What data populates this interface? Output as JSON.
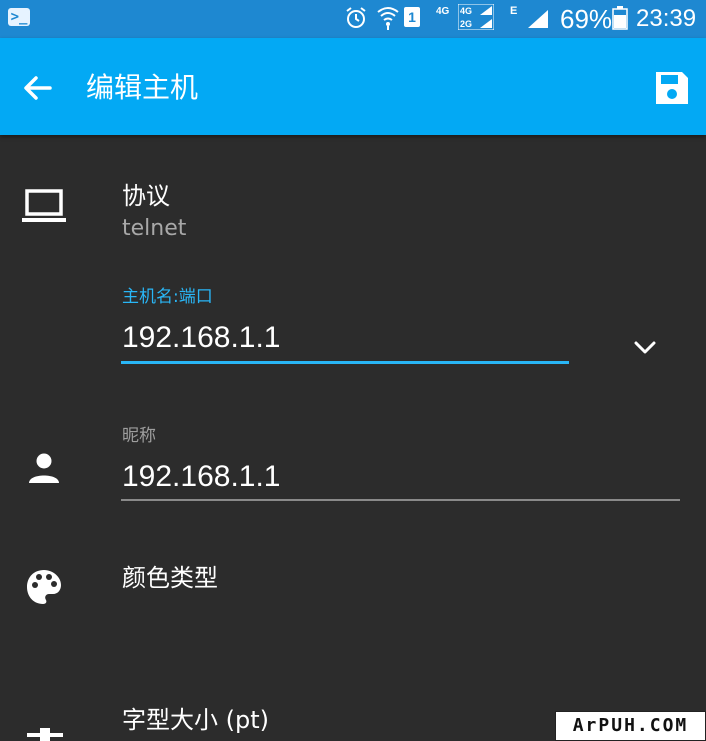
{
  "status_bar": {
    "network_4g": "4G",
    "network_e": "E",
    "sim_slot": "1",
    "battery_percent": "69%",
    "time": "23:39"
  },
  "app_bar": {
    "title": "编辑主机"
  },
  "protocol": {
    "label": "协议",
    "value": "telnet"
  },
  "host": {
    "label": "主机名:端口",
    "value": "192.168.1.1"
  },
  "nickname": {
    "label": "昵称",
    "value": "192.168.1.1"
  },
  "color_type": {
    "label": "颜色类型"
  },
  "font_size": {
    "label": "字型大小 (pt)"
  },
  "watermark": "ArPUH.COM",
  "colors": {
    "status_bar": "#1e88d1",
    "app_bar": "#03a9f4",
    "background": "#2c2c2c",
    "accent": "#29b6f6"
  }
}
